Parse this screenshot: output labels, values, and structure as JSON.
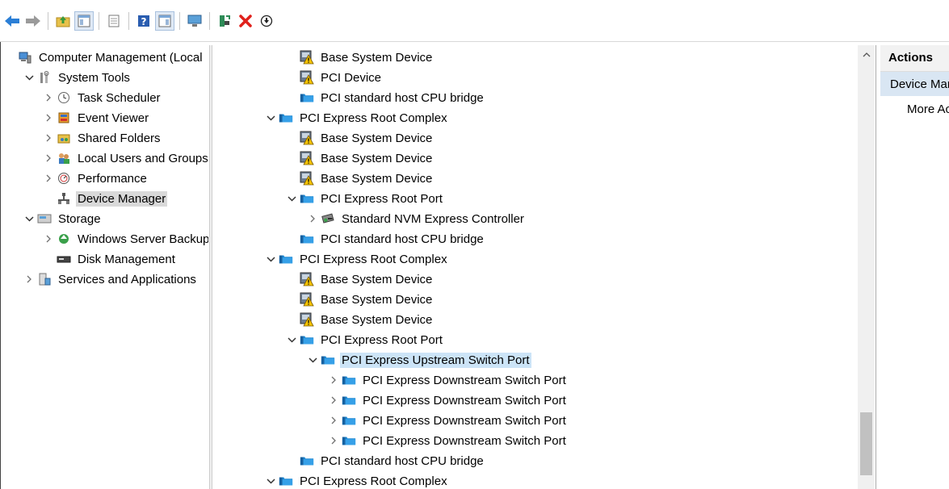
{
  "toolbar": {
    "buttons": [
      {
        "name": "back-button",
        "icon": "back-arrow-icon"
      },
      {
        "name": "forward-button",
        "icon": "forward-arrow-icon"
      },
      {
        "name": "up-level-button",
        "icon": "folder-up-icon"
      },
      {
        "name": "show-hide-console-tree-button",
        "icon": "console-tree-icon"
      },
      {
        "name": "properties-button",
        "icon": "properties-icon"
      },
      {
        "name": "help-button",
        "icon": "help-icon"
      },
      {
        "name": "show-hide-action-pane-button",
        "icon": "action-pane-icon"
      },
      {
        "name": "scan-hardware-button",
        "icon": "monitor-scan-icon"
      },
      {
        "name": "update-driver-button",
        "icon": "update-driver-icon"
      },
      {
        "name": "uninstall-device-button",
        "icon": "red-x-icon"
      },
      {
        "name": "disable-device-button",
        "icon": "down-circle-icon"
      }
    ]
  },
  "left_tree": [
    {
      "label": "Computer Management (Local",
      "icon": "computer-management-icon",
      "level": 0,
      "expander": "none"
    },
    {
      "label": "System Tools",
      "icon": "tools-icon",
      "level": 1,
      "expander": "expanded"
    },
    {
      "label": "Task Scheduler",
      "icon": "clock-icon",
      "level": 2,
      "expander": "collapsed"
    },
    {
      "label": "Event Viewer",
      "icon": "event-viewer-icon",
      "level": 2,
      "expander": "collapsed"
    },
    {
      "label": "Shared Folders",
      "icon": "shared-folder-icon",
      "level": 2,
      "expander": "collapsed"
    },
    {
      "label": "Local Users and Groups",
      "icon": "users-icon",
      "level": 2,
      "expander": "collapsed"
    },
    {
      "label": "Performance",
      "icon": "performance-icon",
      "level": 2,
      "expander": "collapsed"
    },
    {
      "label": "Device Manager",
      "icon": "device-manager-icon",
      "level": 2,
      "expander": "none",
      "selected": true
    },
    {
      "label": "Storage",
      "icon": "storage-icon",
      "level": 1,
      "expander": "expanded"
    },
    {
      "label": "Windows Server Backup",
      "icon": "backup-icon",
      "level": 2,
      "expander": "collapsed"
    },
    {
      "label": "Disk Management",
      "icon": "disk-icon",
      "level": 2,
      "expander": "none"
    },
    {
      "label": "Services and Applications",
      "icon": "services-icon",
      "level": 1,
      "expander": "collapsed"
    }
  ],
  "device_tree": [
    {
      "label": "Base System Device",
      "icon": "warning-device-icon",
      "level": 2,
      "expander": "none"
    },
    {
      "label": "PCI Device",
      "icon": "warning-device-icon",
      "level": 2,
      "expander": "none"
    },
    {
      "label": "PCI standard host CPU bridge",
      "icon": "system-device-icon",
      "level": 2,
      "expander": "none"
    },
    {
      "label": "PCI Express Root Complex",
      "icon": "system-device-icon",
      "level": 1,
      "expander": "expanded"
    },
    {
      "label": "Base System Device",
      "icon": "warning-device-icon",
      "level": 2,
      "expander": "none"
    },
    {
      "label": "Base System Device",
      "icon": "warning-device-icon",
      "level": 2,
      "expander": "none"
    },
    {
      "label": "Base System Device",
      "icon": "warning-device-icon",
      "level": 2,
      "expander": "none"
    },
    {
      "label": "PCI Express Root Port",
      "icon": "system-device-icon",
      "level": 2,
      "expander": "expanded"
    },
    {
      "label": "Standard NVM Express Controller",
      "icon": "storage-controller-icon",
      "level": 3,
      "expander": "collapsed"
    },
    {
      "label": "PCI standard host CPU bridge",
      "icon": "system-device-icon",
      "level": 2,
      "expander": "none"
    },
    {
      "label": "PCI Express Root Complex",
      "icon": "system-device-icon",
      "level": 1,
      "expander": "expanded"
    },
    {
      "label": "Base System Device",
      "icon": "warning-device-icon",
      "level": 2,
      "expander": "none"
    },
    {
      "label": "Base System Device",
      "icon": "warning-device-icon",
      "level": 2,
      "expander": "none"
    },
    {
      "label": "Base System Device",
      "icon": "warning-device-icon",
      "level": 2,
      "expander": "none"
    },
    {
      "label": "PCI Express Root Port",
      "icon": "system-device-icon",
      "level": 2,
      "expander": "expanded"
    },
    {
      "label": "PCI Express Upstream Switch Port",
      "icon": "system-device-icon",
      "level": 3,
      "expander": "expanded",
      "selected": true
    },
    {
      "label": "PCI Express Downstream Switch Port",
      "icon": "system-device-icon",
      "level": 4,
      "expander": "collapsed"
    },
    {
      "label": "PCI Express Downstream Switch Port",
      "icon": "system-device-icon",
      "level": 4,
      "expander": "collapsed"
    },
    {
      "label": "PCI Express Downstream Switch Port",
      "icon": "system-device-icon",
      "level": 4,
      "expander": "collapsed"
    },
    {
      "label": "PCI Express Downstream Switch Port",
      "icon": "system-device-icon",
      "level": 4,
      "expander": "collapsed"
    },
    {
      "label": "PCI standard host CPU bridge",
      "icon": "system-device-icon",
      "level": 2,
      "expander": "none"
    },
    {
      "label": "PCI Express Root Complex",
      "icon": "system-device-icon",
      "level": 1,
      "expander": "expanded"
    }
  ],
  "actions": {
    "header": "Actions",
    "section": "Device Manager",
    "item": "More Actions"
  },
  "colors": {
    "selected_blue": "#cce4f7",
    "selected_grey": "#d9d9d9",
    "folder_blue": "#1e88d2",
    "warning_yellow": "#f5c400"
  }
}
